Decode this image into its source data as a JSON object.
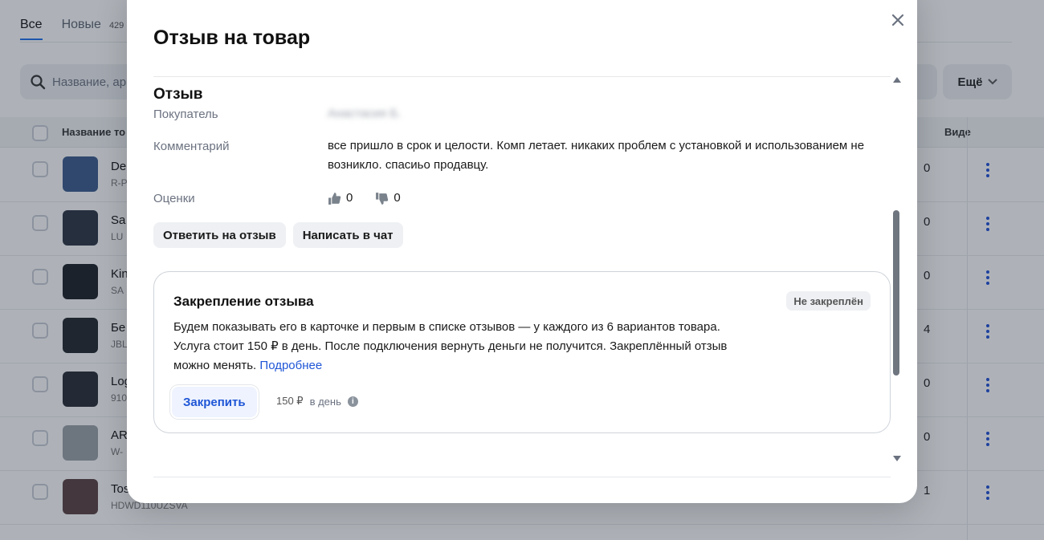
{
  "background": {
    "tabs": [
      {
        "label": "Все",
        "count": ""
      },
      {
        "label": "Новые",
        "count": "429"
      }
    ],
    "search_placeholder": "Название, ар",
    "more_label": "Ещё",
    "columns": {
      "name": "Название то",
      "views": "Виде"
    },
    "rows": [
      {
        "title": "De",
        "subtitle": "R-P",
        "value": "0",
        "thumb_color": "#3a5a8c"
      },
      {
        "title": "Sa",
        "subtitle": "LU",
        "value": "0",
        "thumb_color": "#2b3340"
      },
      {
        "title": "Kin",
        "subtitle": "SA",
        "value": "0",
        "thumb_color": "#1c1f24"
      },
      {
        "title": "Бе",
        "subtitle": "JBL",
        "value": "4",
        "thumb_color": "#20242a"
      },
      {
        "title": "Log",
        "subtitle": "910",
        "value": "0",
        "thumb_color": "#262b33"
      },
      {
        "title": "AR",
        "subtitle": "W-",
        "value": "0",
        "thumb_color": "#9aa0a6"
      },
      {
        "title": "Tos",
        "subtitle": "HDWD110UZSVA",
        "value": "1",
        "thumb_color": "#5a4040"
      }
    ]
  },
  "modal": {
    "title": "Отзыв на товар",
    "section_title": "Отзыв",
    "buyer_label": "Покупатель",
    "buyer_value": "Анастасия Б.",
    "comment_label": "Комментарий",
    "comment_value": "все пришло в срок и целости. Комп летает. никаких проблем с установкой и использованием не возникло. спасиьо продавцу.",
    "ratings_label": "Оценки",
    "likes": "0",
    "dislikes": "0",
    "reply_button": "Ответить на отзыв",
    "chat_button": "Написать в чат",
    "pin": {
      "title": "Закрепление отзыва",
      "status": "Не закреплён",
      "text_line1": "Будем показывать его в карточке и первым в списке отзывов — у каждого из 6 вариантов товара.",
      "text_line2": "Услуга стоит 150 ₽ в день. После подключения вернуть деньги не получится. Закреплённый отзыв",
      "text_line3": "можно менять.",
      "link": "Подробнее",
      "button": "Закрепить",
      "price": "150 ₽",
      "price_unit": "в день"
    }
  },
  "colors": {
    "accent": "#1f56d6",
    "overlay": "#aab0b9"
  }
}
